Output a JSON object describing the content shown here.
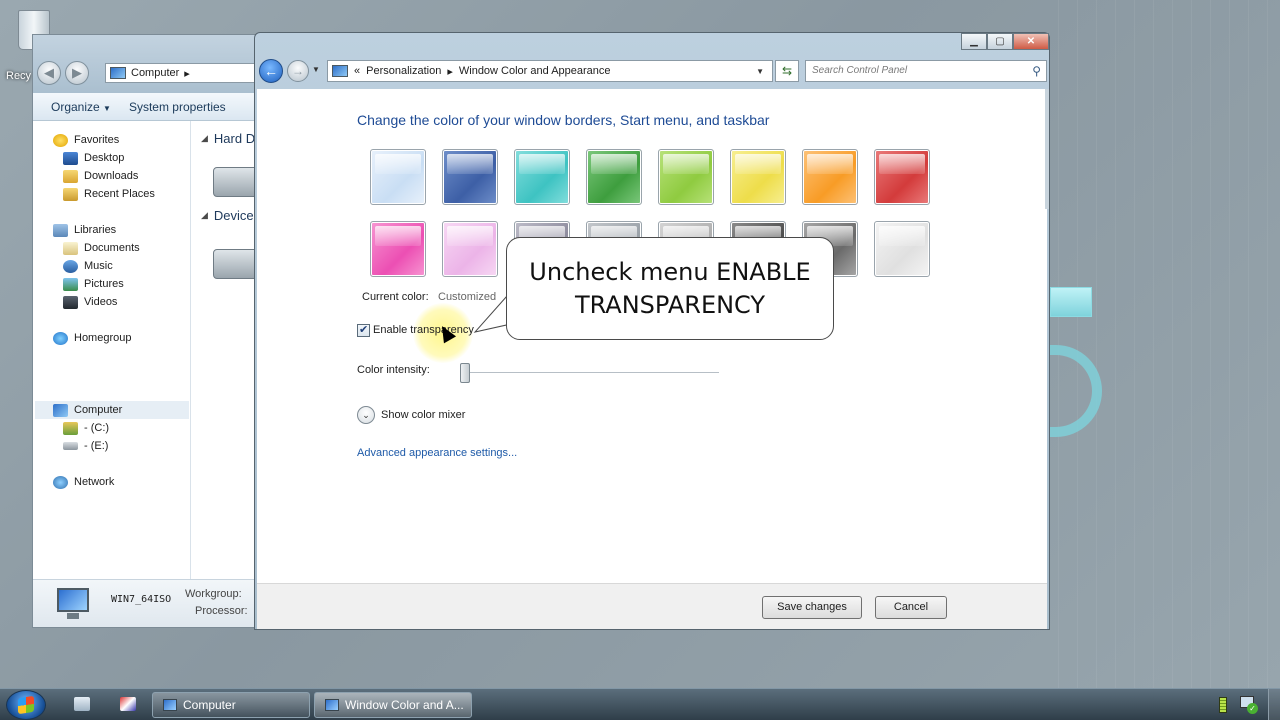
{
  "desktop": {
    "recycle_bin_label": "Recy"
  },
  "explorer": {
    "address": "Computer",
    "toolbar": {
      "organize": "Organize",
      "system_properties": "System properties"
    },
    "sidebar": {
      "favorites": "Favorites",
      "desktop": "Desktop",
      "downloads": "Downloads",
      "recent_places": "Recent Places",
      "libraries": "Libraries",
      "documents": "Documents",
      "music": "Music",
      "pictures": "Pictures",
      "videos": "Videos",
      "homegroup": "Homegroup",
      "computer": "Computer",
      "drive_c": "- (C:)",
      "drive_e": "- (E:)",
      "network": "Network"
    },
    "groups": {
      "hard_disk": "Hard D",
      "devices": "Device"
    },
    "status": {
      "computer_name": "WIN7_64ISO",
      "workgroup": "Workgroup:",
      "processor": "Processor:"
    }
  },
  "main": {
    "breadcrumb": {
      "chevron": "«",
      "personalization": "Personalization",
      "current": "Window Color and Appearance"
    },
    "search_placeholder": "Search Control Panel",
    "heading": "Change the color of your window borders, Start menu, and taskbar",
    "swatches": [
      {
        "color": "#e8f1fb",
        "accent": "#c9def4"
      },
      {
        "color": "#6f8fca",
        "accent": "#3d5fa6"
      },
      {
        "color": "#84dedd",
        "accent": "#3ec3c2"
      },
      {
        "color": "#7cc87c",
        "accent": "#3e9e3e"
      },
      {
        "color": "#b8e27a",
        "accent": "#8fcb40"
      },
      {
        "color": "#f7ef92",
        "accent": "#eedd4a"
      },
      {
        "color": "#fdc278",
        "accent": "#f89c26"
      },
      {
        "color": "#ea7b7b",
        "accent": "#d33b3b"
      },
      {
        "color": "#f796d2",
        "accent": "#ec4fb3"
      },
      {
        "color": "#f7d8f4",
        "accent": "#ecb4e8"
      },
      {
        "color": "#bdbcc8",
        "accent": "#8e8c9e"
      },
      {
        "color": "#c4c8cc",
        "accent": "#9aa1a8"
      },
      {
        "color": "#d4d4d4",
        "accent": "#b0b0b0"
      },
      {
        "color": "#8c8c8c",
        "accent": "#4f4f4f"
      },
      {
        "color": "#a8a8a8",
        "accent": "#6a6a6a"
      },
      {
        "color": "#f4f4f4",
        "accent": "#e0e0e0"
      }
    ],
    "current_color_label": "Current color:",
    "current_color_value": "Customized",
    "enable_transparency_label": "Enable transparency",
    "enable_transparency_checked": true,
    "color_intensity_label": "Color intensity:",
    "color_intensity_value": 0.0,
    "show_color_mixer": "Show color mixer",
    "advanced_link": "Advanced appearance settings...",
    "save_changes": "Save changes",
    "cancel": "Cancel"
  },
  "callout": {
    "text": "Uncheck menu ENABLE TRANSPARENCY"
  },
  "taskbar": {
    "task_computer": "Computer",
    "task_window_color": "Window Color and A..."
  }
}
